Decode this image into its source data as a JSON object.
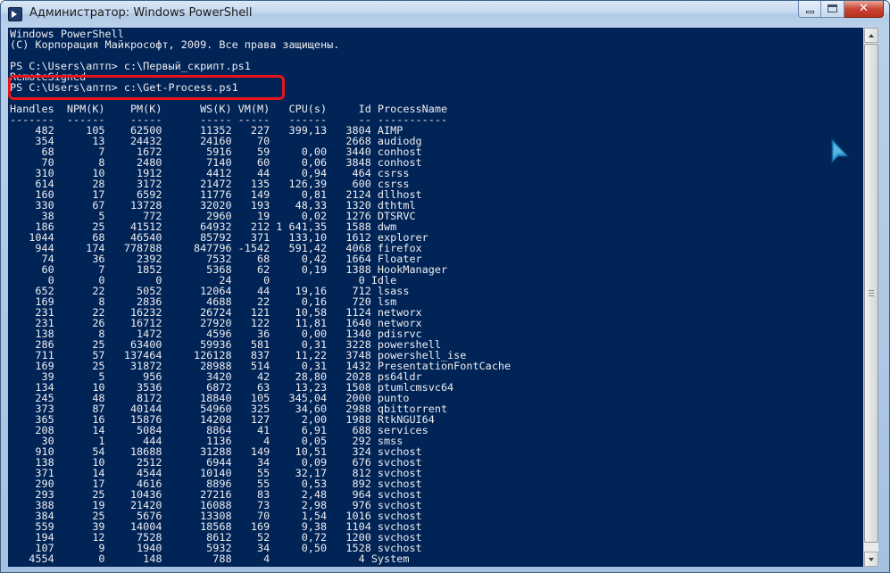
{
  "window": {
    "title": "Администратор: Windows PowerShell",
    "icon": "powershell-icon",
    "buttons": {
      "minimize": "minimize-icon",
      "maximize": "maximize-icon",
      "close": "close-icon",
      "close_glyph": "✕"
    }
  },
  "colors": {
    "console_background": "#012456",
    "console_text": "#eeedf0",
    "highlight": "#e8141c"
  },
  "console": {
    "banner": [
      "Windows PowerShell",
      "(C) Корпорация Майкрософт, 2009. Все права защищены."
    ],
    "blank_1": " ",
    "prompt_1": "PS C:\\Users\\аптп> c:\\Первый_скрипт.ps1",
    "output_1": "RemoteSigned",
    "prompt_2": "PS C:\\Users\\аптп> c:\\Get-Process.ps1",
    "blank_2": " ",
    "table": {
      "header": "Handles  NPM(K)    PM(K)      WS(K) VM(M)   CPU(s)     Id ProcessName",
      "separator": "-------  ------    -----      ----- -----   ------     -- -----------",
      "rows": [
        "    482     105    62500      11352   227   399,13   3804 AIMP",
        "    354      13    24432      24160    70            2668 audiodg",
        "     68       7     1672       5916    59     0,00   3440 conhost",
        "     70       8     2480       7140    60     0,06   3848 conhost",
        "    310      10     1912       4412    44     0,94    464 csrss",
        "    614      28     3172      21472   135   126,39    600 csrss",
        "    160      17     6592      11776   149     0,81   2124 dllhost",
        "    330      67    13728      32020   193    48,33   1320 dthtml",
        "     38       5      772       2960    19     0,02   1276 DTSRVC",
        "    186      25    41512      64932   212 1 641,35   1588 dwm",
        "   1044      68    46540      85792   371   133,10   1612 explorer",
        "    944     174   778788     847796 -1542   591,42   4068 firefox",
        "     74      36     2392       7532    68     0,42   1664 Floater",
        "     60       7     1852       5368    62     0,19   1388 HookManager",
        "      0       0        0         24     0              0 Idle",
        "    652      22     5052      12064    44    19,16    712 lsass",
        "    169       8     2836       4688    22     0,16    720 lsm",
        "    231      22    16232      26724   121    10,58   1124 networx",
        "    231      26    16712      27920   122    11,81   1640 networx",
        "    138       8     1472       4596    36     0,00   1340 pdisrvc",
        "    286      25    63400      59936   581     0,31   3228 powershell",
        "    711      57   137464     126128   837    11,22   3748 powershell_ise",
        "    169      25    31872      28988   514     0,31   1432 PresentationFontCache",
        "     39       5      956       3420    42    28,80   2028 ps64ldr",
        "    134      10     3536       6872    63    13,23   1508 ptumlcmsvc64",
        "    245      48     8172      18840   105   345,04   2000 punto",
        "    373      87    40144      54960   325    34,60   2988 qbittorrent",
        "    365      16    15876      14208   127     2,00   1988 RtkNGUI64",
        "    208      14     5084       8864    41     6,91    688 services",
        "     30       1      444       1136     4     0,05    292 smss",
        "    910      54    18688      31288   149    10,51    324 svchost",
        "    138      10     2512       6944    34     0,09    676 svchost",
        "    371      14     4544      10140    55    32,17    812 svchost",
        "    290      17     4616       8896    55     0,53    892 svchost",
        "    293      25    10436      27216    83     2,48    964 svchost",
        "    388      19    21420      16088    73     2,98    976 svchost",
        "    384      25     5676      13308    70     1,54   1016 svchost",
        "    559      39    14004      18568   169     9,38   1104 svchost",
        "    194      12     7528       8612    52     0,72   1200 svchost",
        "    107       9     1940       5932    34     0,50   1528 svchost",
        "   4554       0      148        788     4              4 System"
      ]
    }
  },
  "scrollbar": {
    "up_icon": "scroll-up-arrow-icon",
    "down_icon": "scroll-down-arrow-icon"
  },
  "pointer": "mouse-cursor-icon"
}
